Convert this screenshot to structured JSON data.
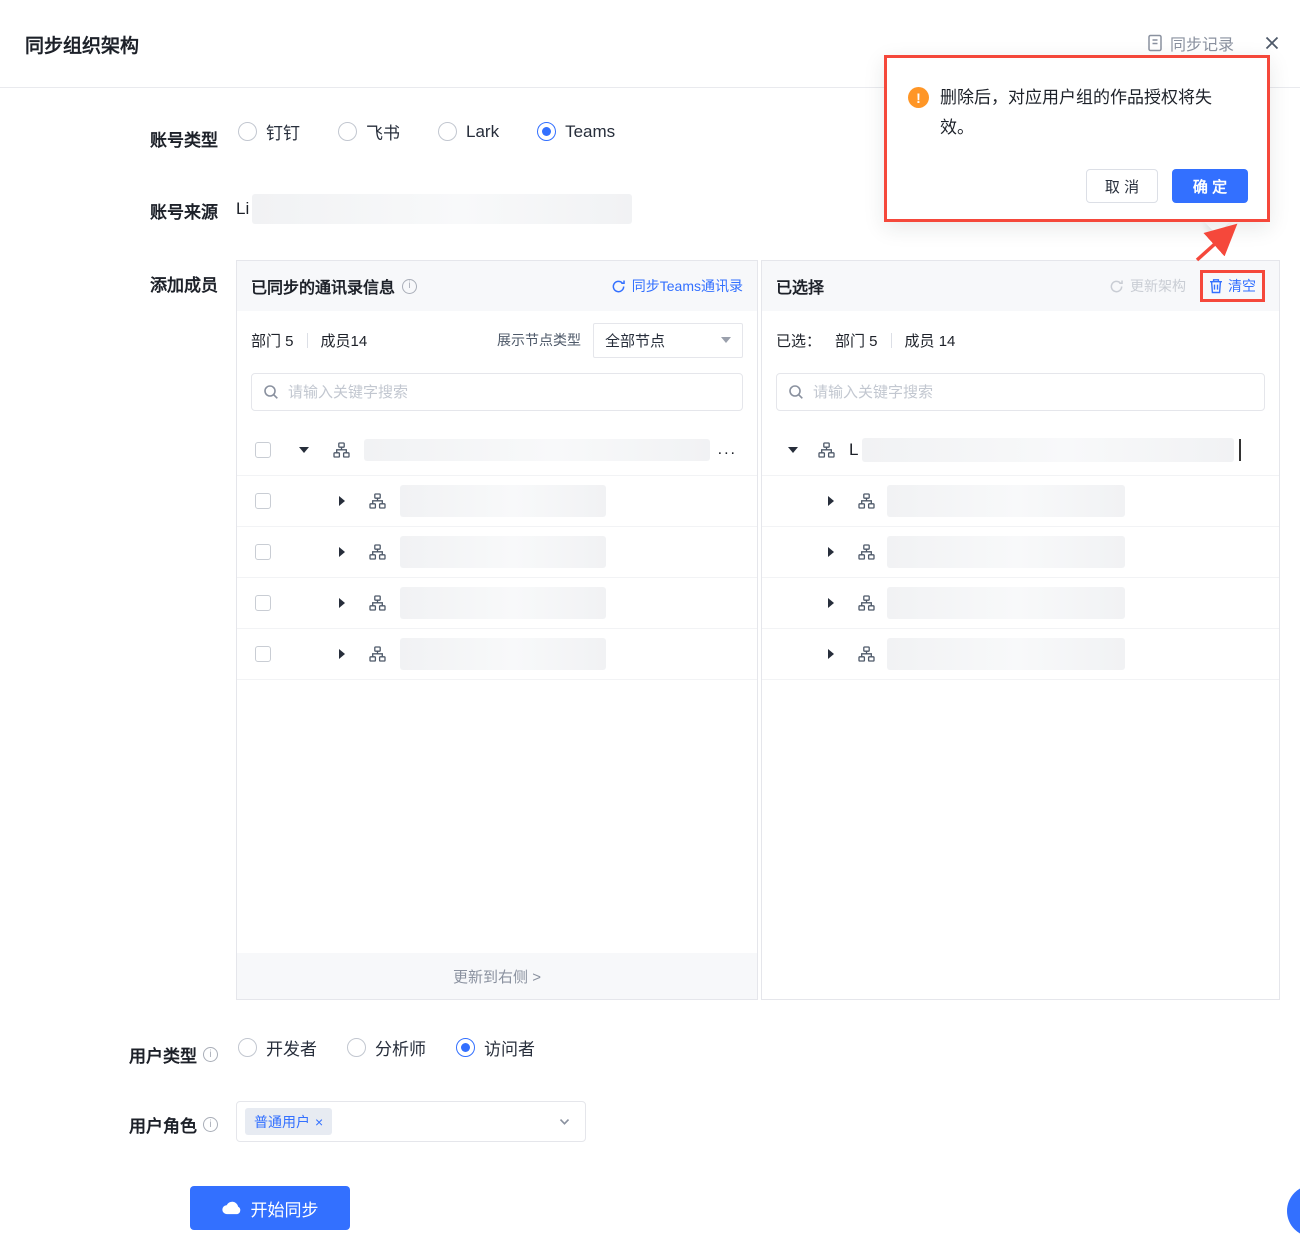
{
  "colors": {
    "accent": "#3370ff",
    "annotation": "#f5483b",
    "warning": "#ff9626"
  },
  "header": {
    "title": "同步组织架构",
    "sync_record": "同步记录"
  },
  "account_type": {
    "label": "账号类型",
    "options": [
      {
        "label": "钉钉",
        "selected": false
      },
      {
        "label": "飞书",
        "selected": false
      },
      {
        "label": "Lark",
        "selected": false
      },
      {
        "label": "Teams",
        "selected": true
      }
    ]
  },
  "account_source": {
    "label": "账号来源",
    "value": "Li"
  },
  "add_members": {
    "label": "添加成员"
  },
  "left_panel": {
    "title": "已同步的通讯录信息",
    "sync_link": "同步Teams通讯录",
    "dept_stat": "部门 5",
    "member_stat": "成员14",
    "node_type_label": "展示节点类型",
    "node_type_value": "全部节点",
    "search_placeholder": "请输入关键字搜索",
    "root_more": "...",
    "footer_action": "更新到右侧 >"
  },
  "right_panel": {
    "title": "已选择",
    "update_action": "更新架构",
    "clear_action": "清空",
    "selected_label": "已选：",
    "dept_stat": "部门 5",
    "member_stat": "成员 14",
    "search_placeholder": "请输入关键字搜索",
    "root_prefix": "L"
  },
  "popup": {
    "message": "删除后，对应用户组的作品授权将失效。",
    "cancel": "取 消",
    "confirm": "确 定"
  },
  "user_type": {
    "label": "用户类型",
    "options": [
      {
        "label": "开发者",
        "selected": false
      },
      {
        "label": "分析师",
        "selected": false
      },
      {
        "label": "访问者",
        "selected": true
      }
    ]
  },
  "user_role": {
    "label": "用户角色",
    "tag": "普通用户",
    "tag_close": "×"
  },
  "submit": {
    "label": "开始同步"
  }
}
